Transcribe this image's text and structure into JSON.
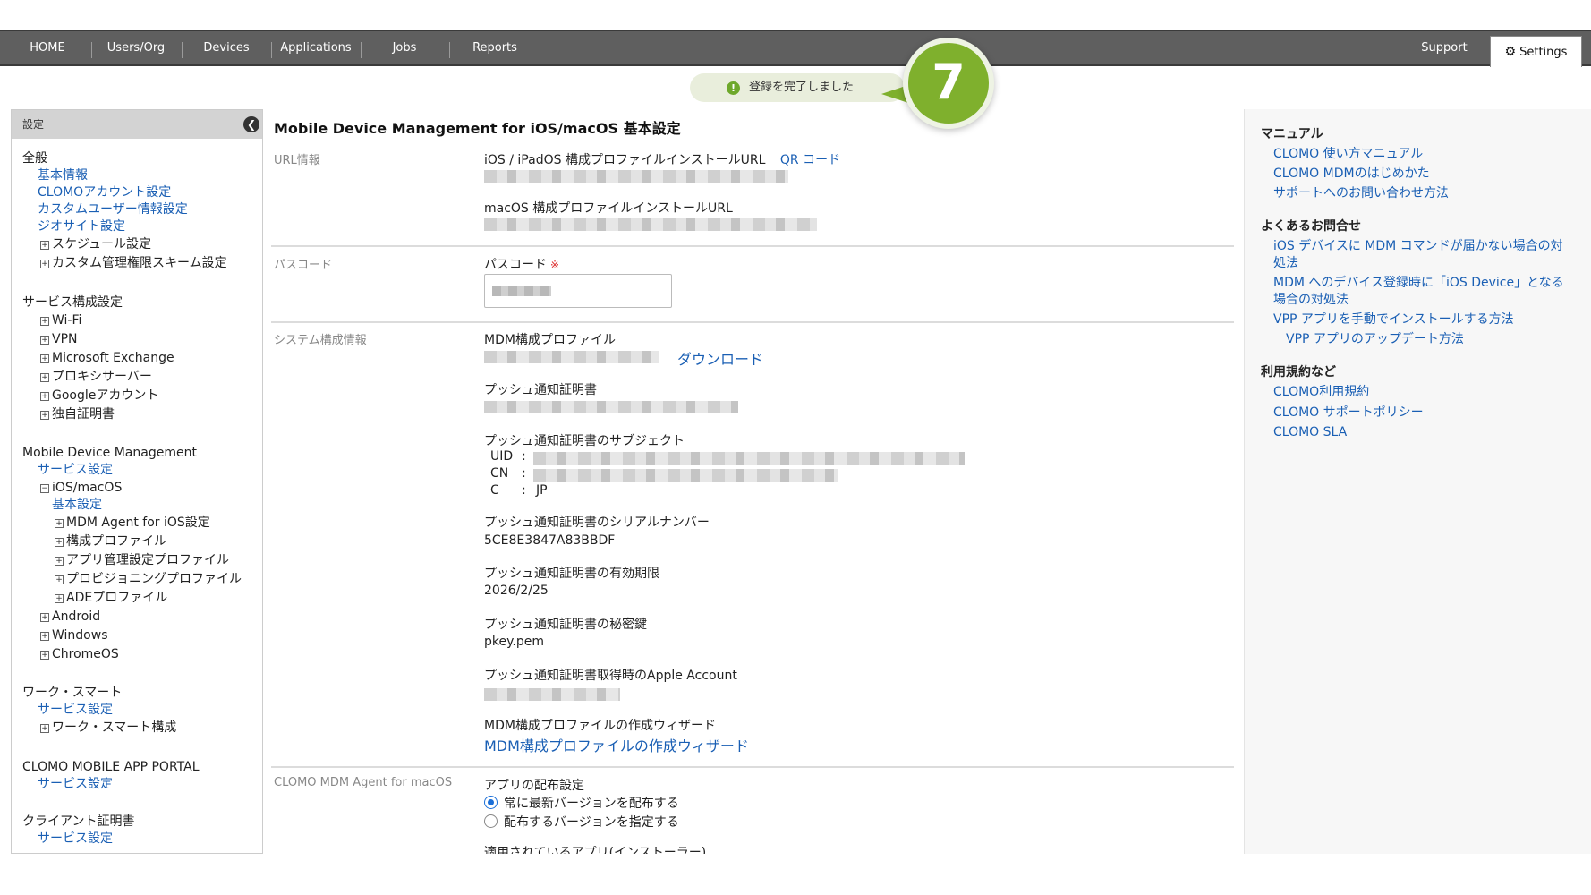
{
  "nav": {
    "items": [
      "HOME",
      "Users/Org",
      "Devices",
      "Applications",
      "Jobs",
      "Reports"
    ],
    "support": "Support",
    "settings": "Settings"
  },
  "toast": {
    "icon": "!",
    "message": "登録を完了しました",
    "step_number": "7"
  },
  "sidebar": {
    "header": "設定",
    "general": {
      "title": "全般",
      "links": [
        "基本情報",
        "CLOMOアカウント設定",
        "カスタムユーザー情報設定",
        "ジオサイト設定"
      ],
      "trees": [
        "スケジュール設定",
        "カスタム管理権限スキーム設定"
      ]
    },
    "service": {
      "title": "サービス構成設定",
      "trees": [
        "Wi-Fi",
        "VPN",
        "Microsoft Exchange",
        "プロキシサーバー",
        "Googleアカウント",
        "独自証明書"
      ]
    },
    "mdm": {
      "title": "Mobile Device Management",
      "service_link": "サービス設定",
      "ios_tree": "iOS/macOS",
      "ios_basic_link": "基本設定",
      "ios_children": [
        "MDM Agent for iOS設定",
        "構成プロファイル",
        "アプリ管理設定プロファイル",
        "プロビジョニングプロファイル",
        "ADEプロファイル"
      ],
      "others": [
        "Android",
        "Windows",
        "ChromeOS"
      ]
    },
    "work_smart": {
      "title": "ワーク・スマート",
      "link": "サービス設定",
      "tree": "ワーク・スマート構成"
    },
    "portal": {
      "title": "CLOMO MOBILE APP PORTAL",
      "link": "サービス設定"
    },
    "client_cert": {
      "title": "クライアント証明書",
      "link": "サービス設定"
    }
  },
  "main": {
    "title": "Mobile Device Management for iOS/macOS 基本設定",
    "url_section": {
      "label": "URL情報",
      "ios_label": "iOS / iPadOS 構成プロファイルインストールURL",
      "qr_link": "QR コード",
      "macos_label": "macOS 構成プロファイルインストールURL"
    },
    "passcode_section": {
      "label": "パスコード",
      "field_label": "パスコード",
      "required_mark": "※"
    },
    "system_section": {
      "label": "システム構成情報",
      "mdm_profile_label": "MDM構成プロファイル",
      "download_link": "ダウンロード",
      "push_cert_label": "プッシュ通知証明書",
      "subject_label": "プッシュ通知証明書のサブジェクト",
      "uid_key": "UID",
      "cn_key": "CN",
      "c_key": "C",
      "colon": ":",
      "c_value": "JP",
      "serial_label": "プッシュ通知証明書のシリアルナンバー",
      "serial_value": "5CE8E3847A83BBDF",
      "expiry_label": "プッシュ通知証明書の有効期限",
      "expiry_value": "2026/2/25",
      "key_label": "プッシュ通知証明書の秘密鍵",
      "key_value": "pkey.pem",
      "apple_label": "プッシュ通知証明書取得時のApple Account",
      "wizard_label": "MDM構成プロファイルの作成ウィザード",
      "wizard_link": "MDM構成プロファイルの作成ウィザード"
    },
    "agent_section": {
      "label": "CLOMO MDM Agent for macOS",
      "dist_label": "アプリの配布設定",
      "options": [
        "常に最新バージョンを配布する",
        "配布するバージョンを指定する"
      ],
      "selected_option": "常に最新バージョンを配布する",
      "applied_label": "適用されているアプリ(インストーラー)"
    }
  },
  "right_panel": {
    "manual_title": "マニュアル",
    "manual_links": [
      "CLOMO 使い方マニュアル",
      "CLOMO MDMのはじめかた",
      "サポートへのお問い合わせ方法"
    ],
    "faq_title": "よくあるお問合せ",
    "faq_links": [
      {
        "line1": "iOS デバイスに MDM コマンドが届かない場合の対",
        "line2": "処法"
      },
      {
        "line1": "MDM へのデバイス登録時に「iOS Device」となる",
        "line2": "場合の対処法"
      },
      {
        "line1": "VPP アプリを手動でインストールする方法",
        "line2": ""
      },
      {
        "line1": "VPP アプリのアップデート方法",
        "line2": ""
      }
    ],
    "terms_title": "利用規約など",
    "terms_links": [
      "CLOMO利用規約",
      "CLOMO サポートポリシー",
      "CLOMO SLA"
    ]
  },
  "colors": {
    "nav_bg": "#5f5f5f",
    "link": "#1a5fb4",
    "toast_bg": "#e9eedc",
    "step_badge": "#7fb02d"
  }
}
